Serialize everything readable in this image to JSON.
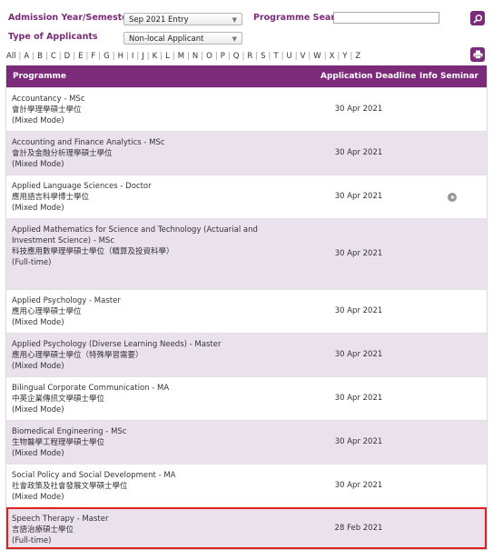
{
  "filters": {
    "admission_label": "Admission Year/Semester",
    "admission_value": "Sep 2021 Entry",
    "applicant_label": "Type of Applicants",
    "applicant_value": "Non-local Applicant",
    "search_label": "Programme Search",
    "search_value": ""
  },
  "alphabet": [
    "All",
    "A",
    "B",
    "C",
    "D",
    "E",
    "F",
    "G",
    "H",
    "I",
    "J",
    "K",
    "L",
    "M",
    "N",
    "O",
    "P",
    "Q",
    "R",
    "S",
    "T",
    "U",
    "V",
    "W",
    "X",
    "Y",
    "Z"
  ],
  "table": {
    "headers": {
      "programme": "Programme",
      "deadline": "Application Deadline",
      "seminar": "Info Seminar"
    },
    "rows": [
      {
        "en": "Accountancy - MSc",
        "zh": "會計學理學碩士學位",
        "mode": "(Mixed Mode)",
        "deadline": "30 Apr 2021",
        "seminar_icon": ""
      },
      {
        "en": "Accounting and Finance Analytics - MSc",
        "zh": "會計及金融分析理學碩士學位",
        "mode": "(Mixed Mode)",
        "deadline": "30 Apr 2021",
        "seminar_icon": ""
      },
      {
        "en": "Applied Language Sciences - Doctor",
        "zh": "應用語言科學博士學位",
        "mode": "(Mixed Mode)",
        "deadline": "30 Apr 2021",
        "seminar_icon": "play-icon"
      },
      {
        "en": "Applied Mathematics for Science and Technology (Actuarial and Investment Science) - MSc",
        "zh": "科技應用數學理學碩士學位（精算及投資科學）",
        "mode": "(Full-time)",
        "deadline": "30 Apr 2021",
        "seminar_icon": ""
      },
      {
        "en": "Applied Psychology - Master",
        "zh": "應用心理學碩士學位",
        "mode": "(Mixed Mode)",
        "deadline": "30 Apr 2021",
        "seminar_icon": ""
      },
      {
        "en": "Applied Psychology (Diverse Learning Needs) - Master",
        "zh": "應用心理學碩士學位（特殊學習需要）",
        "mode": "(Mixed Mode)",
        "deadline": "30 Apr 2021",
        "seminar_icon": ""
      },
      {
        "en": "Bilingual Corporate Communication - MA",
        "zh": "中英企業傳訊文學碩士學位",
        "mode": "(Mixed Mode)",
        "deadline": "30 Apr 2021",
        "seminar_icon": ""
      },
      {
        "en": "Biomedical Engineering - MSc",
        "zh": "生物醫學工程理學碩士學位",
        "mode": "(Mixed Mode)",
        "deadline": "30 Apr 2021",
        "seminar_icon": ""
      },
      {
        "en": "Social Policy and Social Development - MA",
        "zh": "社會政策及社會發展文學碩士學位",
        "mode": "(Mixed Mode)",
        "deadline": "30 Apr 2021",
        "seminar_icon": ""
      },
      {
        "en": "Speech Therapy - Master",
        "zh": "言語治療碩士學位",
        "mode": "(Full-time)",
        "deadline": "28 Feb 2021",
        "seminar_icon": ""
      }
    ]
  },
  "colors": {
    "brand": "#7b2b7a",
    "row_alt": "#e9e1ec",
    "highlight": "#e02020"
  }
}
